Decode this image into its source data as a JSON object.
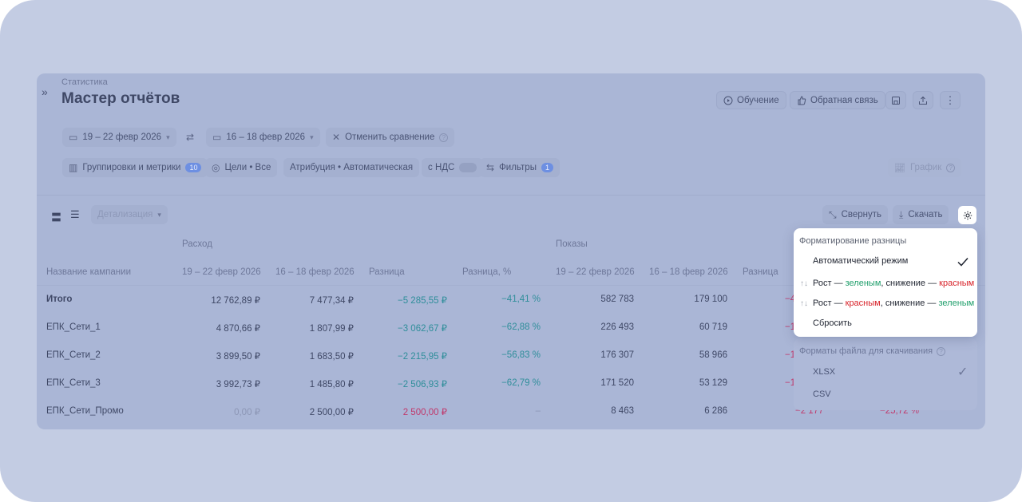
{
  "header": {
    "breadcrumb": "Статистика",
    "title": "Мастер отчётов",
    "buttons": {
      "learning": "Обучение",
      "feedback": "Обратная связь"
    }
  },
  "filters": {
    "date_range": "19 – 22 февр 2026",
    "compare_range": "16 – 18 февр 2026",
    "cancel_compare": "Отменить сравнение",
    "groupings": "Группировки и метрики",
    "groupings_count": "10",
    "goals": "Цели • Все",
    "attribution": "Атрибуция • Автоматическая",
    "vat": "с НДС",
    "filters": "Фильтры",
    "filters_count": "1",
    "graph": "График"
  },
  "toolbar": {
    "detail": "Детализация",
    "collapse": "Свернуть",
    "download": "Скачать"
  },
  "table": {
    "groups": [
      "Расход",
      "Показы"
    ],
    "columns": [
      "Название кампании",
      "19 – 22 февр 2026",
      "16 – 18 февр 2026",
      "Разница",
      "Разница, %",
      "19 – 22 февр 2026",
      "16 – 18 февр 2026",
      "Разница"
    ],
    "rows": [
      {
        "name": "Итого",
        "c1": "12 762,89 ₽",
        "c2": "7 477,34 ₽",
        "diff": "−5 285,55 ₽",
        "pct": "−41,41 %",
        "s1": "582 783",
        "s2": "179 100",
        "sdiff": "−4",
        "spct": ""
      },
      {
        "name": "ЕПК_Сети_1",
        "c1": "4 870,66 ₽",
        "c2": "1 807,99 ₽",
        "diff": "−3 062,67 ₽",
        "pct": "−62,88 %",
        "s1": "226 493",
        "s2": "60 719",
        "sdiff": "−1",
        "spct": ""
      },
      {
        "name": "ЕПК_Сети_2",
        "c1": "3 899,50 ₽",
        "c2": "1 683,50 ₽",
        "diff": "−2 215,95 ₽",
        "pct": "−56,83 %",
        "s1": "176 307",
        "s2": "58 966",
        "sdiff": "−1",
        "spct": ""
      },
      {
        "name": "ЕПК_Сети_3",
        "c1": "3 992,73 ₽",
        "c2": "1 485,80 ₽",
        "diff": "−2 506,93 ₽",
        "pct": "−62,79 %",
        "s1": "171 520",
        "s2": "53 129",
        "sdiff": "−1",
        "spct": ""
      },
      {
        "name": "ЕПК_Сети_Промо",
        "c1": "0,00 ₽",
        "c2": "2 500,00 ₽",
        "diff": "2 500,00 ₽",
        "pct": "–",
        "s1": "8 463",
        "s2": "6 286",
        "sdiff": "−2 177",
        "spct": "−25,72 %"
      }
    ]
  },
  "menu": {
    "header": "Форматирование разницы",
    "auto": "Автоматический режим",
    "opt1": {
      "prefix": "Рост — ",
      "a": "зеленым",
      "mid": ", снижение — ",
      "b": "красным"
    },
    "opt2": {
      "prefix": "Рост — ",
      "a": "красным",
      "mid": ", снижение — ",
      "b": "зеленым"
    },
    "reset": "Сбросить",
    "formats_header": "Форматы файла для скачивания",
    "xlsx": "XLSX",
    "csv": "CSV"
  },
  "colors": {
    "positive": "#1e9e6a",
    "negative": "#d8232a"
  }
}
